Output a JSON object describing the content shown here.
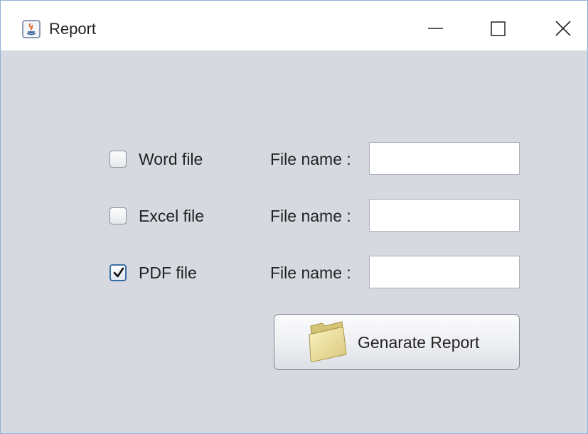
{
  "window": {
    "title": "Report",
    "controls": {
      "minimize_icon": "minimize-icon",
      "maximize_icon": "maximize-icon",
      "close_icon": "close-icon"
    }
  },
  "form": {
    "rows": [
      {
        "checkbox_label": "Word file",
        "checked": false,
        "field_label": "File name :",
        "field_value": ""
      },
      {
        "checkbox_label": "Excel file",
        "checked": false,
        "field_label": "File name :",
        "field_value": ""
      },
      {
        "checkbox_label": "PDF file",
        "checked": true,
        "field_label": "File name :",
        "field_value": ""
      }
    ],
    "generate_button": {
      "label": "Genarate Report",
      "icon": "folder-icon"
    }
  },
  "colors": {
    "background": "#d6d9e0",
    "titlebar": "#ffffff",
    "checkbox_checked_border": "#3a6ea8",
    "folder": "#e8dc9a"
  }
}
